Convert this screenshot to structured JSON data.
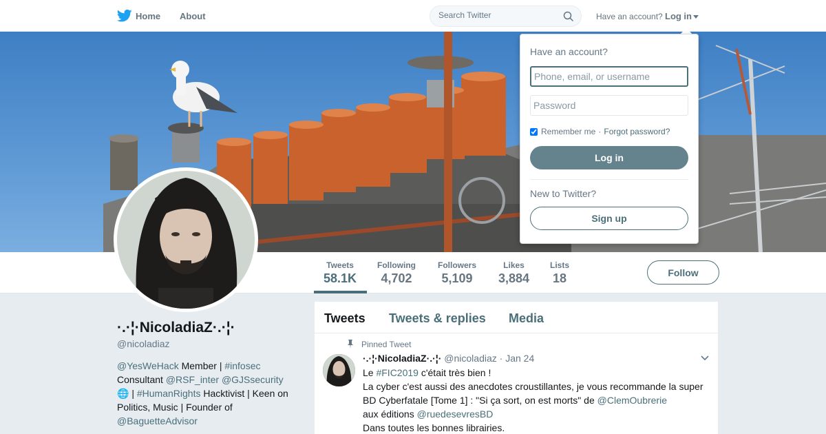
{
  "nav": {
    "home_label": "Home",
    "about_label": "About",
    "search_placeholder": "Search Twitter",
    "have_account": "Have an account?",
    "login_label": "Log in"
  },
  "profile": {
    "name": "·.·¦·NicoladiaZ·.·¦·",
    "handle": "@nicoladiaz",
    "follow_label": "Follow",
    "bio": {
      "l1a": "@YesWeHack",
      "l1b": " Member | ",
      "l1c": "#infosec",
      "l2a": "Consultant ",
      "l2b": "@RSF_inter",
      "l2c": " ",
      "l2d": "@GJSsecurity",
      "l3a": "🌐",
      "l3b": " | ",
      "l3c": "#HumanRights",
      "l3d": " Hacktivist | Keen on",
      "l4": "Politics, Music | Founder of",
      "l5": "@BaguetteAdvisor"
    }
  },
  "stats": [
    {
      "label": "Tweets",
      "value": "58.1K"
    },
    {
      "label": "Following",
      "value": "4,702"
    },
    {
      "label": "Followers",
      "value": "5,109"
    },
    {
      "label": "Likes",
      "value": "3,884"
    },
    {
      "label": "Lists",
      "value": "18"
    }
  ],
  "timeline": {
    "tabs": [
      "Tweets",
      "Tweets & replies",
      "Media"
    ],
    "pinned_label": "Pinned Tweet",
    "tweet": {
      "name": "·.·¦·NicoladiaZ·.·¦·",
      "handle": "@nicoladiaz",
      "dot": " · ",
      "date": "Jan 24",
      "line1a": "Le ",
      "line1b": "#FIC2019",
      "line1c": " c'était très bien !",
      "line2": "La cyber c'est aussi des anecdotes croustillantes, je vous recommande la super",
      "line3a": "BD Cyberfatale [Tome 1] : \"Si ça sort, on est morts\" de ",
      "line3b": "@ClemOubrerie",
      "line4a": "aux éditions ",
      "line4b": "@ruedesevresBD",
      "line5": "Dans toutes les bonnes librairies."
    }
  },
  "login_dropdown": {
    "title": "Have an account?",
    "username_placeholder": "Phone, email, or username",
    "password_placeholder": "Password",
    "remember_label": "Remember me",
    "separator": "·",
    "forgot_label": "Forgot password?",
    "login_button": "Log in",
    "new_label": "New to Twitter?",
    "signup_button": "Sign up"
  },
  "colors": {
    "accent": "#4a6f7a",
    "login_button_bg": "#64838d",
    "banner_sky": "#4a8bcb"
  }
}
